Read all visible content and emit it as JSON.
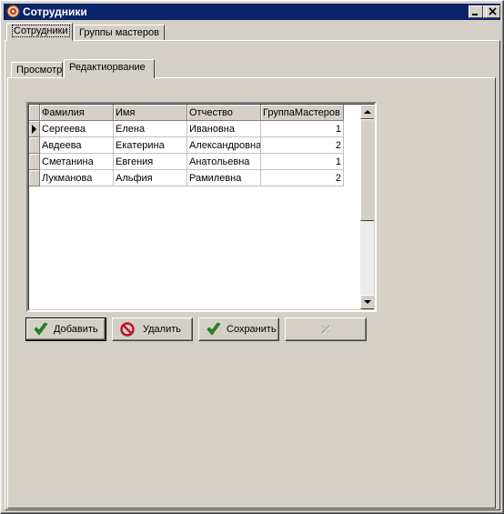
{
  "window": {
    "title": "Сотрудники",
    "icon": "app-icon"
  },
  "titlebar_buttons": [
    "minimize-icon",
    "maximize-icon",
    "close-icon"
  ],
  "outer_tabs": [
    {
      "label": "Сотрудники",
      "selected": true
    },
    {
      "label": "Группы мастеров",
      "selected": false
    }
  ],
  "inner_tabs": [
    {
      "label": "Просмотр",
      "selected": false
    },
    {
      "label": "Редактиорвание",
      "selected": true
    }
  ],
  "grid": {
    "columns": [
      "Фамилия",
      "Имя",
      "Отчество",
      "ГруппаМастеров"
    ],
    "rows": [
      {
        "c0": "Сергеева",
        "c1": "Елена",
        "c2": "Ивановна",
        "c3": "1",
        "current": true
      },
      {
        "c0": "Авдеева",
        "c1": "Екатерина",
        "c2": "Александровна",
        "c3": "2",
        "current": false
      },
      {
        "c0": "Сметанина",
        "c1": "Евгения",
        "c2": "Анатольевна",
        "c3": "1",
        "current": false
      },
      {
        "c0": "Лукманова",
        "c1": "Альфия",
        "c2": "Рамилевна",
        "c3": "2",
        "current": false
      }
    ]
  },
  "buttons": {
    "add": {
      "label": "Добавить",
      "icon": "checkmark-icon"
    },
    "delete": {
      "label": "Удалить",
      "icon": "no-entry-icon"
    },
    "save": {
      "label": "Сохранить",
      "icon": "checkmark-icon"
    },
    "cancel": {
      "label": "",
      "icon": "cross-icon",
      "enabled": false
    }
  },
  "colors": {
    "titlebar": "#0a246a",
    "face": "#d4d0c8",
    "check": "#1e8c1e",
    "noentry": "#c0102a"
  }
}
